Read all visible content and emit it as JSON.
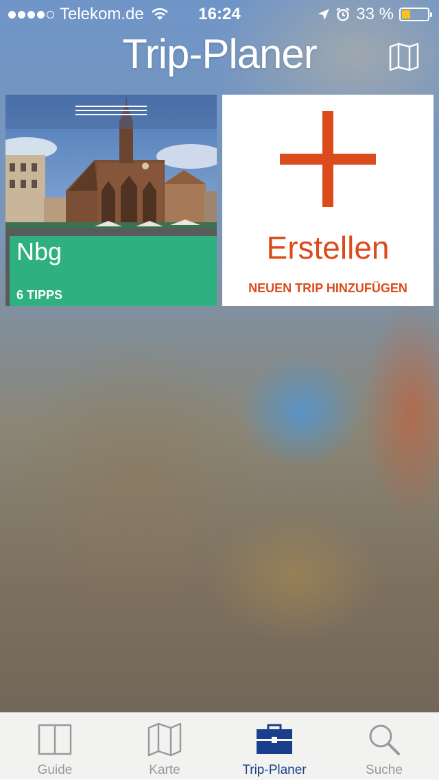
{
  "status_bar": {
    "carrier": "Telekom.de",
    "time": "16:24",
    "battery_text": "33 %",
    "battery_level": 0.33,
    "signal_bars_filled": 4,
    "signal_bars_total": 5
  },
  "header": {
    "title": "Trip-Planer",
    "map_icon": "map-icon"
  },
  "trips": [
    {
      "name": "Nbg",
      "tips_count": "6 TIPPS",
      "photo": "nuremberg-frauenkirche",
      "color": "#2fb080"
    }
  ],
  "add_card": {
    "title": "Erstellen",
    "subtitle": "NEUEN TRIP HINZUFÜGEN",
    "color": "#dc4b1b"
  },
  "tab_bar": {
    "active_color": "#1a3e8c",
    "tabs": [
      {
        "label": "Guide",
        "icon": "book-icon",
        "active": false
      },
      {
        "label": "Karte",
        "icon": "map-icon",
        "active": false
      },
      {
        "label": "Trip-Planer",
        "icon": "briefcase-icon",
        "active": true
      },
      {
        "label": "Suche",
        "icon": "search-icon",
        "active": false
      }
    ]
  }
}
